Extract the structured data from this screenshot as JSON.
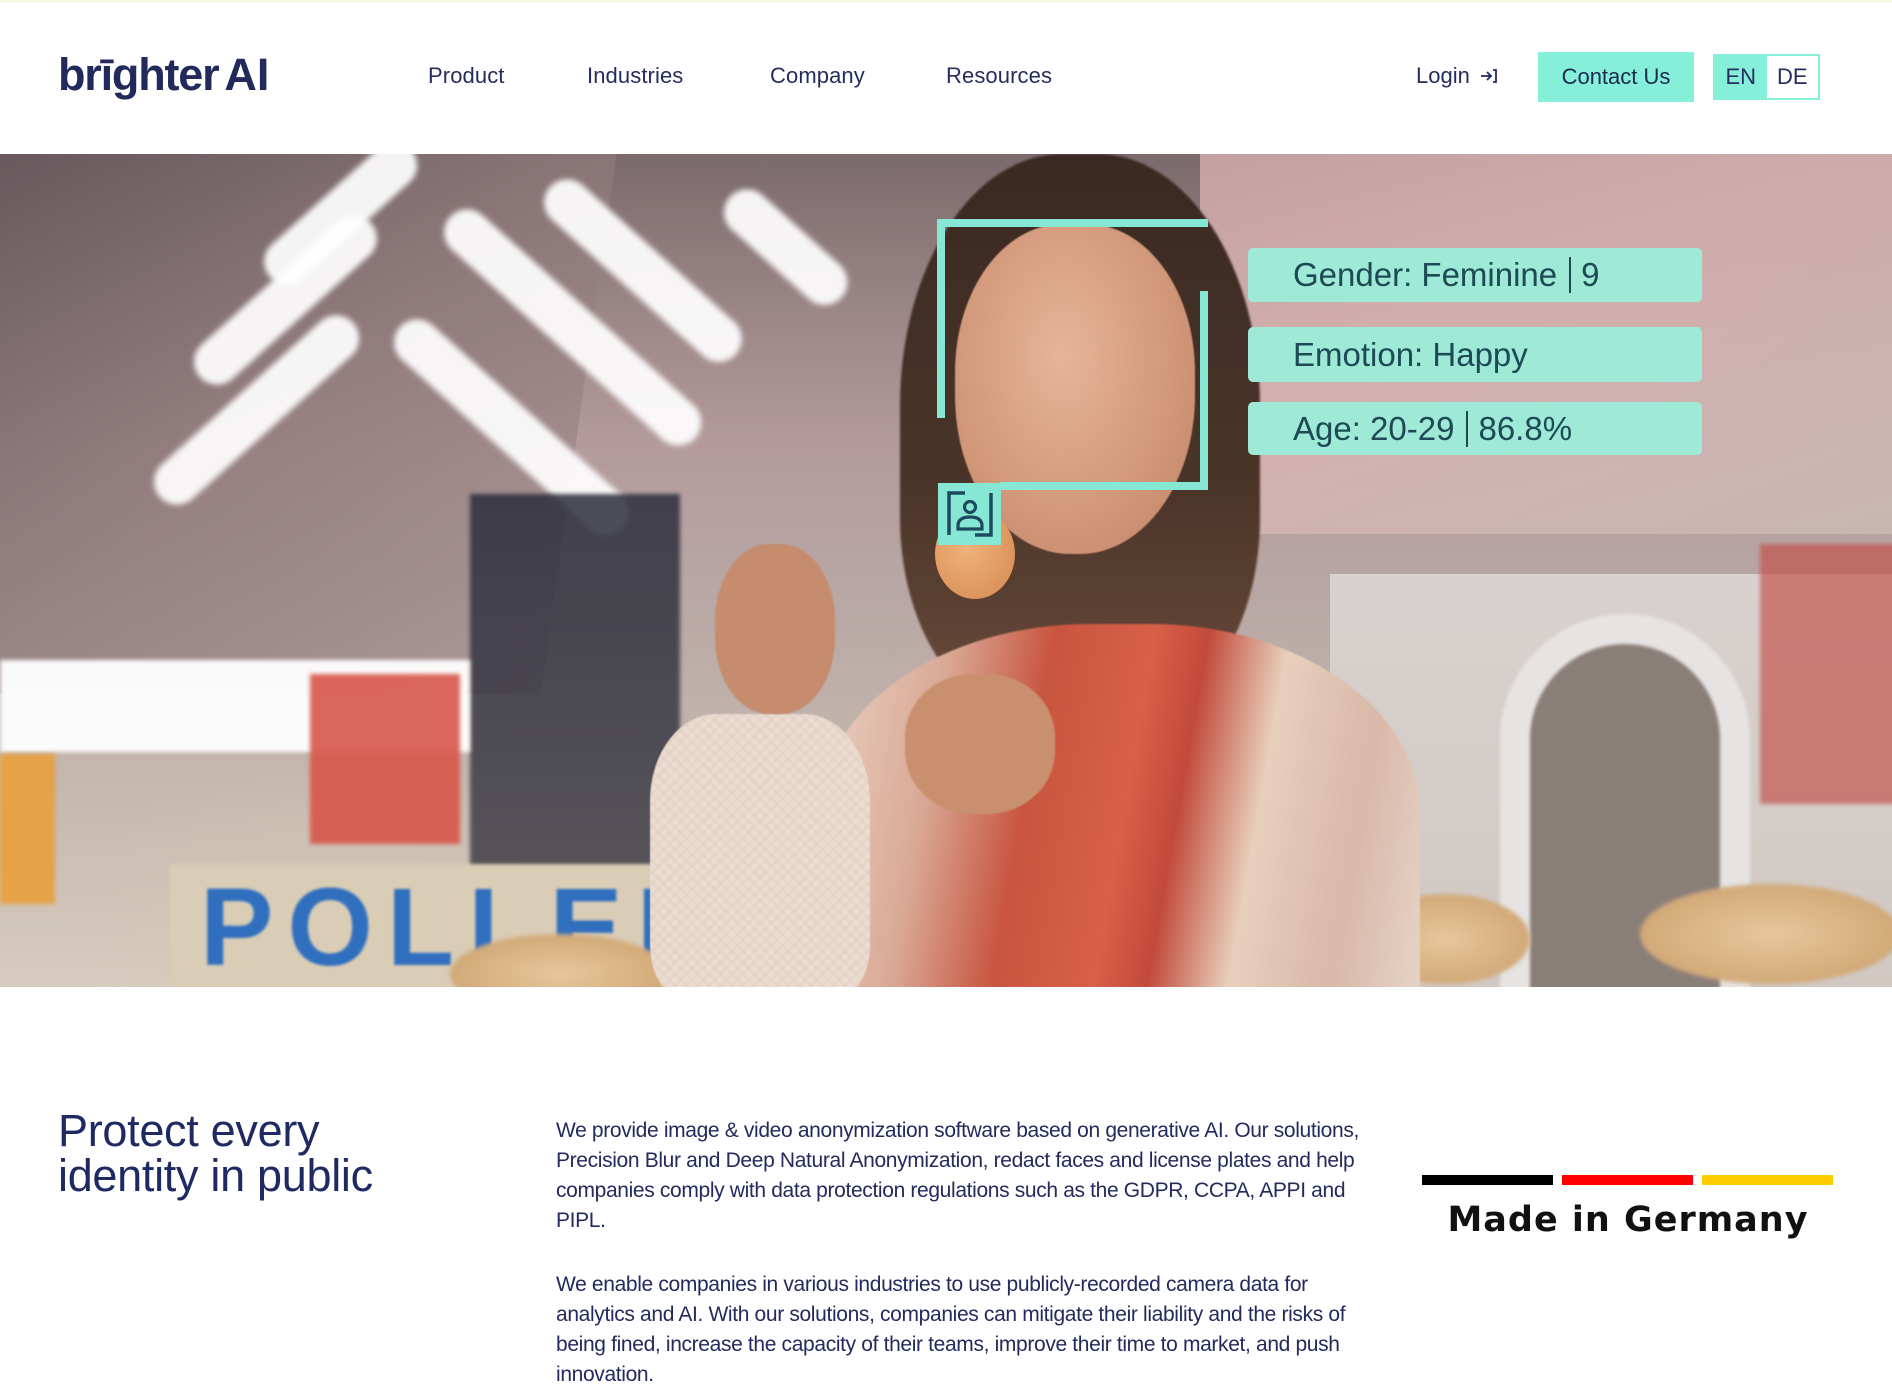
{
  "header": {
    "logo": {
      "main": "brīghter",
      "suffix": "AI"
    },
    "nav": [
      {
        "label": "Product"
      },
      {
        "label": "Industries"
      },
      {
        "label": "Company"
      },
      {
        "label": "Resources"
      }
    ],
    "login": {
      "label": "Login",
      "icon": "login-arrow-icon"
    },
    "contact_button": "Contact Us",
    "languages": [
      {
        "code": "EN",
        "active": true
      },
      {
        "code": "DE",
        "active": false
      }
    ]
  },
  "hero": {
    "image_description": "Woman in a market hall looking at an egg, with a face-detection overlay",
    "overlay": {
      "face_frame_icon": "person-id-icon",
      "labels": [
        {
          "key": "Gender",
          "text": "Gender: Feminine",
          "confidence": "9"
        },
        {
          "key": "Emotion",
          "text": "Emotion: Happy",
          "confidence": ""
        },
        {
          "key": "Age",
          "text": "Age: 20-29",
          "confidence": "86.8%"
        }
      ]
    },
    "background_sign_text": "POLLEFI"
  },
  "intro": {
    "headline": "Protect every\nidentity in public",
    "paragraphs": [
      "We provide image & video anonymization software based on generative AI. Our solutions, Precision Blur and Deep Natural Anonymization, redact faces and license plates and help companies comply with data protection regulations such as the GDPR, CCPA, APPI and PIPL.",
      "We enable companies in various industries to use publicly-recorded camera data for analytics and AI. With our solutions, companies can mitigate their liability and the risks of being fined, increase the capacity of their teams, improve their time to market, and push innovation."
    ],
    "badge": {
      "text": "Made in Germany",
      "flag_colors": [
        "#000000",
        "#ff0000",
        "#ffcc00"
      ]
    }
  },
  "colors": {
    "brand_navy": "#222a5c",
    "accent_mint": "#86efd9",
    "overlay_label_bg": "#9eead7",
    "overlay_label_text": "#1d4a55"
  }
}
